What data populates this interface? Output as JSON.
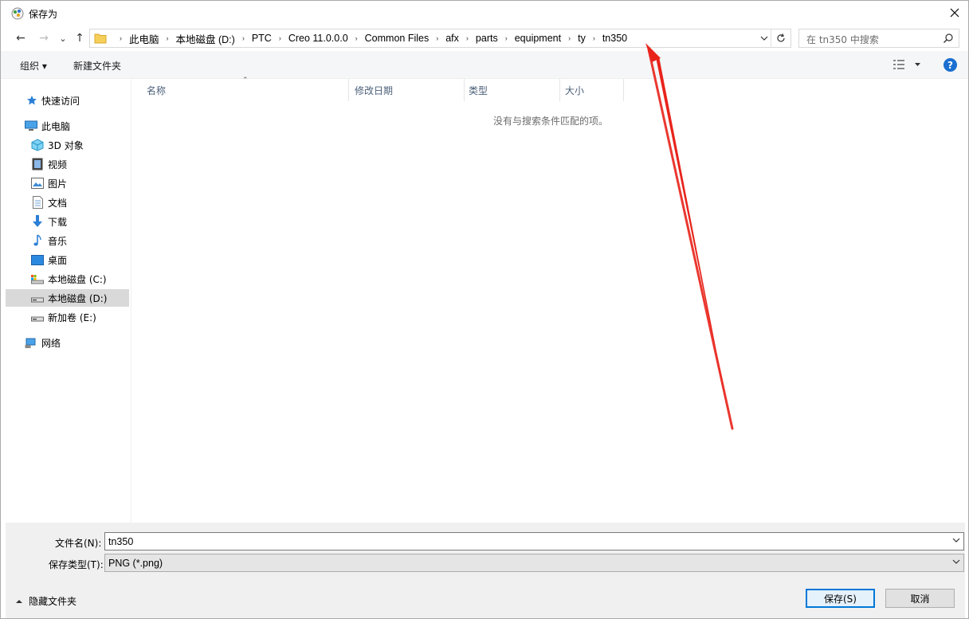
{
  "window": {
    "title": "保存为"
  },
  "nav": {
    "back": "←",
    "forward": "→",
    "recent": "⌄",
    "up": "↑"
  },
  "breadcrumbs": [
    "此电脑",
    "本地磁盘 (D:)",
    "PTC",
    "Creo 11.0.0.0",
    "Common Files",
    "afx",
    "parts",
    "equipment",
    "ty",
    "tn350"
  ],
  "search": {
    "placeholder": "在 tn350 中搜索"
  },
  "toolbar": {
    "organize_label": "组织 ▾",
    "new_folder_label": "新建文件夹"
  },
  "sidebar": {
    "items": [
      {
        "label": "快速访问",
        "icon": "star-icon"
      },
      {
        "label": "此电脑",
        "icon": "computer-icon"
      },
      {
        "label": "3D 对象",
        "icon": "cube-icon"
      },
      {
        "label": "视频",
        "icon": "video-icon"
      },
      {
        "label": "图片",
        "icon": "picture-icon"
      },
      {
        "label": "文档",
        "icon": "document-icon"
      },
      {
        "label": "下载",
        "icon": "download-icon"
      },
      {
        "label": "音乐",
        "icon": "music-icon"
      },
      {
        "label": "桌面",
        "icon": "desktop-icon"
      },
      {
        "label": "本地磁盘 (C:)",
        "icon": "drive-icon"
      },
      {
        "label": "本地磁盘 (D:)",
        "icon": "drive-icon"
      },
      {
        "label": "新加卷 (E:)",
        "icon": "drive-icon"
      },
      {
        "label": "网络",
        "icon": "network-icon"
      }
    ],
    "selected": "本地磁盘 (D:)"
  },
  "columns": [
    "名称",
    "修改日期",
    "类型",
    "大小"
  ],
  "empty_message": "没有与搜索条件匹配的项。",
  "filename": {
    "label": "文件名(N):",
    "value": "tn350"
  },
  "filetype": {
    "label": "保存类型(T):",
    "value": "PNG (*.png)"
  },
  "footer": {
    "hide_folders": "隐藏文件夹",
    "save": "保存(S)",
    "cancel": "取消"
  },
  "colors": {
    "accent": "#0078d7",
    "annotation_arrow": "#e8231a",
    "help": "#1a6fd1"
  }
}
